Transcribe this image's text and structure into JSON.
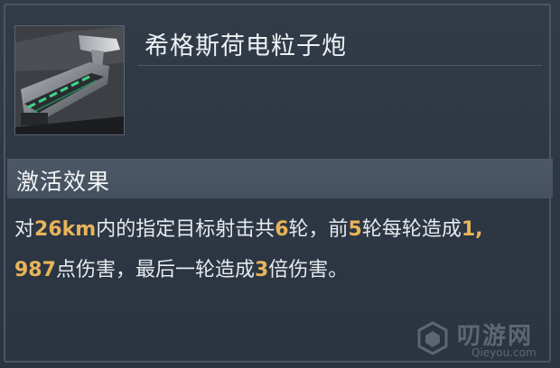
{
  "item": {
    "name": "希格斯荷电粒子炮",
    "icon": "particle-cannon-icon"
  },
  "effect": {
    "header": "激活效果",
    "line1": [
      {
        "t": "对",
        "h": false
      },
      {
        "t": "26km",
        "h": true
      },
      {
        "t": "内的指定目标射击共",
        "h": false
      },
      {
        "t": "6",
        "h": true
      },
      {
        "t": "轮，前",
        "h": false
      },
      {
        "t": "5",
        "h": true
      },
      {
        "t": "轮每轮造成",
        "h": false
      },
      {
        "t": "1,",
        "h": true
      }
    ],
    "line2": [
      {
        "t": "987",
        "h": true
      },
      {
        "t": "点伤害，最后一轮造成",
        "h": false
      },
      {
        "t": "3",
        "h": true
      },
      {
        "t": "倍伤害。",
        "h": false
      }
    ]
  },
  "watermark": {
    "title": "叨游网",
    "site": "Qieyou.com"
  },
  "colors": {
    "panel_bg": "#2e3744",
    "section_bg": "#4a5563",
    "highlight": "#e8b45a",
    "text": "#e7eaee"
  }
}
